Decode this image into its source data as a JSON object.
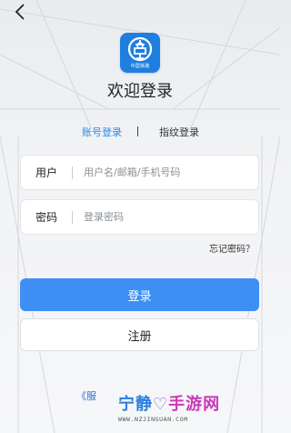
{
  "header": {
    "back_icon": "chevron-left-icon"
  },
  "logo": {
    "icon": "railway-logo-icon",
    "caption": "中国铁路",
    "color": "#1e7fe0"
  },
  "welcome_title": "欢迎登录",
  "tabs": {
    "account": "账号登录",
    "fingerprint": "指纹登录",
    "active_color": "#2a8ae8"
  },
  "form": {
    "username": {
      "label": "用户",
      "placeholder": "用户名/邮箱/手机号码",
      "value": ""
    },
    "password": {
      "label": "密码",
      "placeholder": "登录密码",
      "value": ""
    }
  },
  "forgot_password": "忘记密码？",
  "buttons": {
    "login": "登录",
    "register": "注册",
    "login_color": "#3d8ff3"
  },
  "terms_link": "《服",
  "watermark": {
    "left": "宁静",
    "right": "手游网",
    "url": "WWW.NZJINGUAN.COM"
  }
}
